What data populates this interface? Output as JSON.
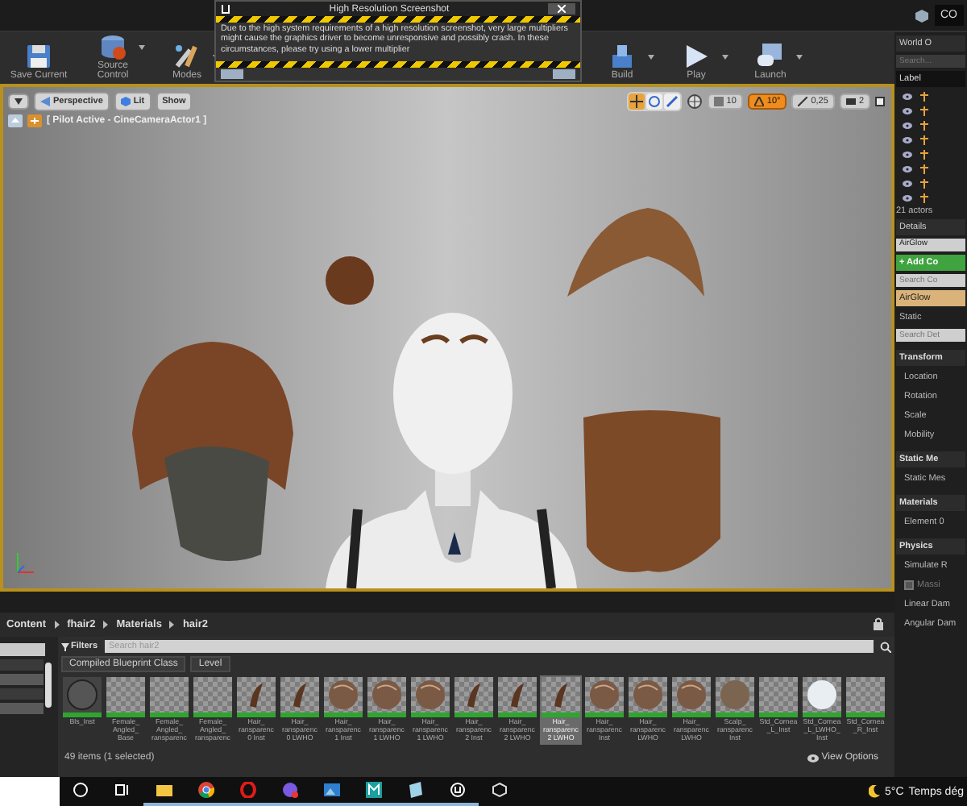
{
  "top_bar": {
    "label": "CO"
  },
  "toolbar": {
    "buttons": [
      {
        "label": "Save Current",
        "kind": "save",
        "dropdown": false
      },
      {
        "label": "Source Control",
        "kind": "source",
        "dropdown": true
      },
      {
        "label": "Modes",
        "kind": "modes",
        "dropdown": true
      },
      {
        "label": "Build",
        "kind": "build",
        "dropdown": true
      },
      {
        "label": "Play",
        "kind": "play",
        "dropdown": true
      },
      {
        "label": "Launch",
        "kind": "launch",
        "dropdown": true
      }
    ]
  },
  "dialog": {
    "title": "High Resolution Screenshot",
    "message": "Due to the high system requirements of a high resolution screenshot, very large multipliers might cause the graphics driver to become unresponsive and possibly crash. In these circumstances, please try using a lower multiplier"
  },
  "viewport": {
    "view_buttons": [
      {
        "label": "Perspective",
        "kind": "perspective"
      },
      {
        "label": "Lit",
        "kind": "lit"
      },
      {
        "label": "Show",
        "kind": "plain"
      }
    ],
    "transform_modes": [
      {
        "kind": "translate",
        "selected": true
      },
      {
        "kind": "rotate",
        "selected": false
      },
      {
        "kind": "scale",
        "selected": false
      }
    ],
    "snap_tools": [
      {
        "kind": "grid",
        "value": "10",
        "selected": false
      },
      {
        "kind": "rotation",
        "value": "10°",
        "selected": true
      },
      {
        "kind": "scale",
        "value": "0,25",
        "selected": false
      },
      {
        "kind": "camera",
        "value": "2",
        "selected": false
      }
    ],
    "pilot_label": "[ Pilot Active - CineCameraActor1 ]"
  },
  "content_browser": {
    "breadcrumb": [
      "Content",
      "fhair2",
      "Materials",
      "hair2"
    ],
    "filters_label": "Filters",
    "search": {
      "placeholder": "Search hair2"
    },
    "filter_chips": [
      "Compiled Blueprint Class",
      "Level"
    ],
    "assets": [
      {
        "label": "Bls_Inst",
        "kind": "dark-sphere",
        "selected": false
      },
      {
        "label": "Female_\nAngled_\nBase",
        "kind": "checker",
        "selected": false
      },
      {
        "label": "Female_\nAngled_\nransparenc",
        "kind": "checker",
        "selected": false
      },
      {
        "label": "Female_\nAngled_\nransparenc",
        "kind": "checker",
        "selected": false
      },
      {
        "label": "Hair_\nransparenc\n0 Inst",
        "kind": "hair",
        "selected": false
      },
      {
        "label": "Hair_\nransparenc\n0 LWHO",
        "kind": "hair",
        "selected": false
      },
      {
        "label": "Hair_\nransparenc\n1 Inst",
        "kind": "hair-sphere",
        "selected": false
      },
      {
        "label": "Hair_\nransparenc\n1 LWHO",
        "kind": "hair-sphere",
        "selected": false
      },
      {
        "label": "Hair_\nransparenc\n1 LWHO",
        "kind": "hair-sphere",
        "selected": false
      },
      {
        "label": "Hair_\nransparenc\n2 Inst",
        "kind": "hair",
        "selected": false
      },
      {
        "label": "Hair_\nransparenc\n2 LWHO",
        "kind": "hair",
        "selected": false
      },
      {
        "label": "Hair_\nransparenc\n2 LWHO",
        "kind": "hair",
        "selected": true
      },
      {
        "label": "Hair_\nransparenc\nInst",
        "kind": "hair-sphere",
        "selected": false
      },
      {
        "label": "Hair_\nransparenc\nLWHO",
        "kind": "hair-sphere",
        "selected": false
      },
      {
        "label": "Hair_\nransparenc\nLWHO",
        "kind": "hair-sphere",
        "selected": false
      },
      {
        "label": "Scalp_\nransparenc\nInst",
        "kind": "brown-sphere",
        "selected": false
      },
      {
        "label": "Std_Cornea\n_L_Inst",
        "kind": "checker",
        "selected": false
      },
      {
        "label": "Std_Cornea\n_L_LWHO_\nInst",
        "kind": "white-sphere",
        "selected": false
      },
      {
        "label": "Std_Cornea\n_R_Inst",
        "kind": "checker",
        "selected": false
      }
    ],
    "status": "49 items (1 selected)",
    "view_options": "View Options"
  },
  "outliner": {
    "title": "World O",
    "search": {
      "placeholder": "Search..."
    },
    "column": "Label",
    "rows": [
      {
        "visible": true
      },
      {
        "visible": true
      },
      {
        "visible": true
      },
      {
        "visible": true
      },
      {
        "visible": true
      },
      {
        "visible": true
      },
      {
        "visible": true
      },
      {
        "visible": true
      }
    ],
    "actor_count": "21 actors"
  },
  "details": {
    "title": "Details",
    "actor_name": "AirGlow",
    "add_button": "+ Add Co",
    "component_search": {
      "placeholder": "Search Co"
    },
    "components": [
      {
        "label": "AirGlow",
        "selected": true
      },
      {
        "label": "Static",
        "selected": false
      }
    ],
    "details_search": {
      "placeholder": "Search Det"
    },
    "sections": [
      {
        "title": "Transform",
        "rows": [
          {
            "label": "Location",
            "kind": "field"
          },
          {
            "label": "Rotation",
            "kind": "field"
          },
          {
            "label": "Scale",
            "kind": "field"
          },
          {
            "label": "Mobility",
            "kind": "field"
          }
        ]
      },
      {
        "title": "Static Me",
        "rows": [
          {
            "label": "Static Mes",
            "kind": "field"
          }
        ]
      },
      {
        "title": "Materials",
        "rows": [
          {
            "label": "Element 0",
            "kind": "field"
          }
        ]
      },
      {
        "title": "Physics",
        "rows": [
          {
            "label": "Simulate R",
            "kind": "field"
          },
          {
            "label": "Massi",
            "kind": "checkbox",
            "checked": false
          },
          {
            "label": "Linear Dam",
            "kind": "field"
          },
          {
            "label": "Angular Dam",
            "kind": "field"
          }
        ]
      }
    ]
  },
  "taskbar": {
    "apps": [
      {
        "kind": "cortana",
        "open": false
      },
      {
        "kind": "taskview",
        "open": false
      },
      {
        "kind": "folder",
        "open": true
      },
      {
        "kind": "chrome",
        "open": true
      },
      {
        "kind": "opera",
        "open": true
      },
      {
        "kind": "messenger",
        "open": true
      },
      {
        "kind": "photos",
        "open": true
      },
      {
        "kind": "m-app",
        "open": true
      },
      {
        "kind": "notes",
        "open": true
      },
      {
        "kind": "unreal",
        "open": true
      },
      {
        "kind": "cube",
        "open": false
      }
    ],
    "temperature": "5°C",
    "weather": "Temps dég"
  }
}
